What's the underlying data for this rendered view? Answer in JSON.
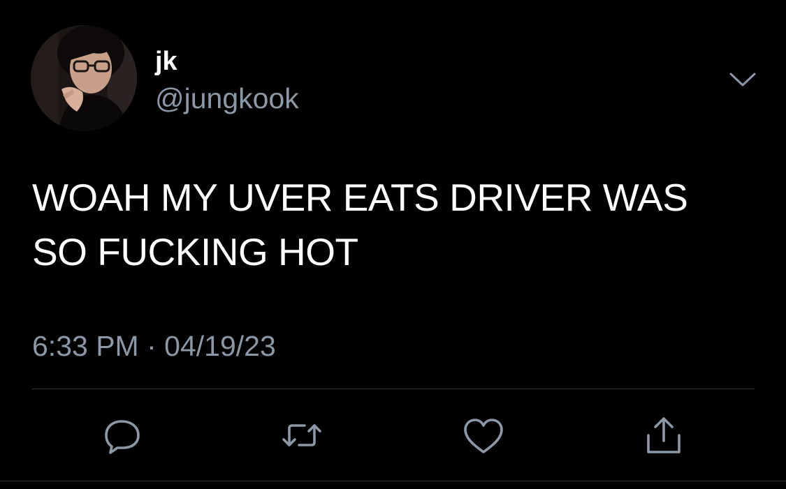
{
  "user": {
    "display_name": "jk",
    "handle": "@jungkook",
    "avatar_icon": "profile-photo"
  },
  "tweet": {
    "text_line1": "WOAH MY UVER EATS DRIVER WAS",
    "text_line2": "SO FUCKING HOT",
    "time": "6:33 PM",
    "separator": "·",
    "date": "04/19/23"
  },
  "actions": [
    {
      "name": "reply",
      "icon": "speech-bubble-icon"
    },
    {
      "name": "retweet",
      "icon": "retweet-arrows-icon"
    },
    {
      "name": "like",
      "icon": "heart-icon"
    },
    {
      "name": "share",
      "icon": "share-upload-icon"
    }
  ],
  "colors": {
    "background": "#000000",
    "text_primary": "#ffffff",
    "text_secondary": "#8b98a5",
    "divider": "#2f3336"
  }
}
